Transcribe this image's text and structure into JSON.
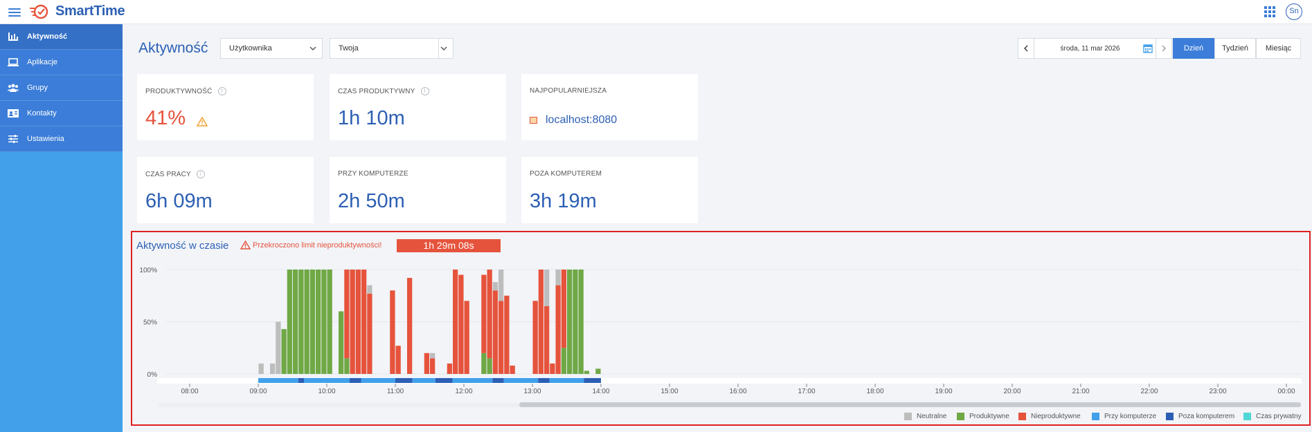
{
  "app": {
    "brand": "SmartTime",
    "avatar_initials": "Sn"
  },
  "sidebar": {
    "items": [
      {
        "label": "Aktywność",
        "icon": "bar-chart-icon",
        "active": true
      },
      {
        "label": "Aplikacje",
        "icon": "laptop-icon",
        "active": false
      },
      {
        "label": "Grupy",
        "icon": "users-icon",
        "active": false
      },
      {
        "label": "Kontakty",
        "icon": "contact-card-icon",
        "active": false
      },
      {
        "label": "Ustawienia",
        "icon": "sliders-icon",
        "active": false
      }
    ]
  },
  "header": {
    "title": "Aktywność",
    "filter_type": "Użytkownika",
    "filter_value": "Twoja",
    "date": "środa, 11 mar 2026",
    "range_options": [
      "Dzień",
      "Tydzień",
      "Miesiąc"
    ],
    "range_selected": "Dzień"
  },
  "stats": {
    "productivity": {
      "label": "Produktywność",
      "value": "41%"
    },
    "productive_time": {
      "label": "Czas produktywny",
      "value": "1h 10m"
    },
    "most_popular": {
      "label": "Najpopularniejsza",
      "value": "localhost:8080"
    },
    "work_time": {
      "label": "Czas pracy",
      "value": "6h 09m"
    },
    "at_computer": {
      "label": "Przy komputerze",
      "value": "2h 50m"
    },
    "away": {
      "label": "Poza komputerem",
      "value": "3h 19m"
    }
  },
  "chart_section": {
    "title": "Aktywność w czasie",
    "warning": "Przekroczono limit nieproduktywności!",
    "exceeded_by": "1h 29m 08s"
  },
  "colors": {
    "neutral": "#bdbdbd",
    "productive": "#6fa845",
    "unproductive": "#e6533c",
    "at_computer": "#42a0eb",
    "away": "#2c5fb4",
    "private": "#4fd6d6",
    "accent": "#3b7dd8"
  },
  "chart_data": {
    "type": "bar",
    "stacked": true,
    "x_unit": "time of day",
    "bin_minutes": 5,
    "xticks": [
      "08:00",
      "09:00",
      "10:00",
      "11:00",
      "12:00",
      "13:00",
      "14:00",
      "15:00",
      "16:00",
      "17:00",
      "18:00",
      "19:00",
      "20:00",
      "21:00",
      "22:00",
      "23:00",
      "00:00"
    ],
    "yticks": [
      "100%",
      "50%",
      "0%"
    ],
    "ylim": [
      0,
      100
    ],
    "grid": true,
    "legend_position": "bottom-right",
    "legend": [
      "Neutralne",
      "Produktywne",
      "Nieproduktywne",
      "Przy komputerze",
      "Poza komputerem",
      "Czas prywatny"
    ],
    "bars": [
      {
        "t": "09:00",
        "neutral": 10,
        "productive": 0,
        "unproductive": 0
      },
      {
        "t": "09:10",
        "neutral": 10,
        "productive": 0,
        "unproductive": 0
      },
      {
        "t": "09:15",
        "neutral": 50,
        "productive": 0,
        "unproductive": 0
      },
      {
        "t": "09:20",
        "neutral": 0,
        "productive": 43,
        "unproductive": 0
      },
      {
        "t": "09:25",
        "neutral": 0,
        "productive": 100,
        "unproductive": 0
      },
      {
        "t": "09:30",
        "neutral": 0,
        "productive": 100,
        "unproductive": 0
      },
      {
        "t": "09:35",
        "neutral": 0,
        "productive": 100,
        "unproductive": 0
      },
      {
        "t": "09:40",
        "neutral": 0,
        "productive": 100,
        "unproductive": 0
      },
      {
        "t": "09:45",
        "neutral": 0,
        "productive": 100,
        "unproductive": 0
      },
      {
        "t": "09:50",
        "neutral": 0,
        "productive": 100,
        "unproductive": 0
      },
      {
        "t": "09:55",
        "neutral": 0,
        "productive": 100,
        "unproductive": 0
      },
      {
        "t": "10:00",
        "neutral": 0,
        "productive": 100,
        "unproductive": 0
      },
      {
        "t": "10:10",
        "neutral": 0,
        "productive": 60,
        "unproductive": 0
      },
      {
        "t": "10:15",
        "neutral": 0,
        "productive": 15,
        "unproductive": 85
      },
      {
        "t": "10:20",
        "neutral": 0,
        "productive": 0,
        "unproductive": 100
      },
      {
        "t": "10:25",
        "neutral": 0,
        "productive": 0,
        "unproductive": 100
      },
      {
        "t": "10:30",
        "neutral": 0,
        "productive": 0,
        "unproductive": 100
      },
      {
        "t": "10:35",
        "neutral": 8,
        "productive": 0,
        "unproductive": 77
      },
      {
        "t": "10:55",
        "neutral": 0,
        "productive": 0,
        "unproductive": 80
      },
      {
        "t": "11:00",
        "neutral": 0,
        "productive": 0,
        "unproductive": 27
      },
      {
        "t": "11:10",
        "neutral": 0,
        "productive": 0,
        "unproductive": 92
      },
      {
        "t": "11:25",
        "neutral": 0,
        "productive": 0,
        "unproductive": 20
      },
      {
        "t": "11:30",
        "neutral": 5,
        "productive": 0,
        "unproductive": 15
      },
      {
        "t": "11:45",
        "neutral": 0,
        "productive": 0,
        "unproductive": 10
      },
      {
        "t": "11:50",
        "neutral": 0,
        "productive": 0,
        "unproductive": 100
      },
      {
        "t": "11:55",
        "neutral": 0,
        "productive": 0,
        "unproductive": 95
      },
      {
        "t": "12:00",
        "neutral": 0,
        "productive": 0,
        "unproductive": 70
      },
      {
        "t": "12:15",
        "neutral": 0,
        "productive": 20,
        "unproductive": 75
      },
      {
        "t": "12:20",
        "neutral": 0,
        "productive": 15,
        "unproductive": 85
      },
      {
        "t": "12:25",
        "neutral": 8,
        "productive": 0,
        "unproductive": 80
      },
      {
        "t": "12:30",
        "neutral": 30,
        "productive": 0,
        "unproductive": 70
      },
      {
        "t": "12:35",
        "neutral": 0,
        "productive": 0,
        "unproductive": 75
      },
      {
        "t": "12:40",
        "neutral": 0,
        "productive": 0,
        "unproductive": 8
      },
      {
        "t": "13:00",
        "neutral": 0,
        "productive": 0,
        "unproductive": 70
      },
      {
        "t": "13:05",
        "neutral": 0,
        "productive": 0,
        "unproductive": 100
      },
      {
        "t": "13:10",
        "neutral": 35,
        "productive": 0,
        "unproductive": 65
      },
      {
        "t": "13:15",
        "neutral": 0,
        "productive": 0,
        "unproductive": 10
      },
      {
        "t": "13:20",
        "neutral": 15,
        "productive": 0,
        "unproductive": 85
      },
      {
        "t": "13:25",
        "neutral": 0,
        "productive": 25,
        "unproductive": 75
      },
      {
        "t": "13:30",
        "neutral": 0,
        "productive": 100,
        "unproductive": 0
      },
      {
        "t": "13:35",
        "neutral": 0,
        "productive": 100,
        "unproductive": 0
      },
      {
        "t": "13:40",
        "neutral": 0,
        "productive": 100,
        "unproductive": 0
      },
      {
        "t": "13:45",
        "neutral": 0,
        "productive": 3,
        "unproductive": 0
      },
      {
        "t": "13:55",
        "neutral": 0,
        "productive": 5,
        "unproductive": 0
      }
    ],
    "presence": [
      {
        "from": "09:00",
        "to": "09:35",
        "state": "at_computer"
      },
      {
        "from": "09:35",
        "to": "09:40",
        "state": "away"
      },
      {
        "from": "09:40",
        "to": "10:20",
        "state": "at_computer"
      },
      {
        "from": "10:20",
        "to": "10:30",
        "state": "away"
      },
      {
        "from": "10:30",
        "to": "11:00",
        "state": "at_computer"
      },
      {
        "from": "11:00",
        "to": "11:15",
        "state": "away"
      },
      {
        "from": "11:15",
        "to": "11:35",
        "state": "at_computer"
      },
      {
        "from": "11:35",
        "to": "11:50",
        "state": "away"
      },
      {
        "from": "11:50",
        "to": "12:25",
        "state": "at_computer"
      },
      {
        "from": "12:25",
        "to": "12:35",
        "state": "away"
      },
      {
        "from": "12:35",
        "to": "13:05",
        "state": "at_computer"
      },
      {
        "from": "13:05",
        "to": "13:15",
        "state": "away"
      },
      {
        "from": "13:15",
        "to": "13:45",
        "state": "at_computer"
      },
      {
        "from": "13:45",
        "to": "14:00",
        "state": "away"
      }
    ]
  }
}
